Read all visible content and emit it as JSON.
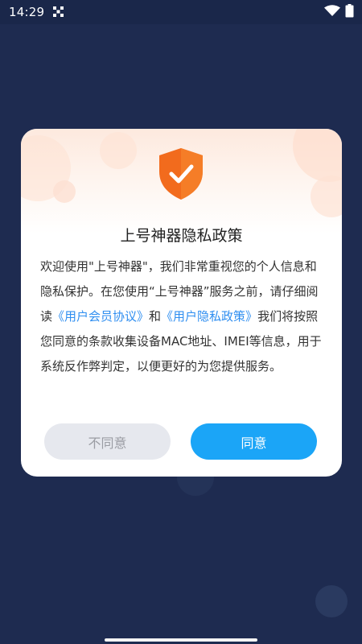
{
  "status_bar": {
    "time": "14:29",
    "icons": [
      "qr-code-icon",
      "wifi-icon",
      "battery-icon"
    ]
  },
  "dialog": {
    "icon": "shield-check-icon",
    "title": "上号神器隐私政策",
    "body_parts": [
      "欢迎使用\"上号神器\"，我们非常重视您的个人信息和隐私保护。在您使用“上号神器”服务之前，请仔细阅读",
      "《用户会员协议》",
      "和",
      "《用户隐私政策》",
      "我们将按照您同意的条款收集设备MAC地址、IMEI等信息，用于系统反作弊判定，以便更好的为您提供服务。"
    ],
    "disagree_label": "不同意",
    "agree_label": "同意"
  },
  "colors": {
    "background": "#1e2b50",
    "accent": "#1ba5f7",
    "link": "#2f8ef0",
    "shield": "#f26b1d",
    "disagree_button": "#e6e8ee"
  }
}
